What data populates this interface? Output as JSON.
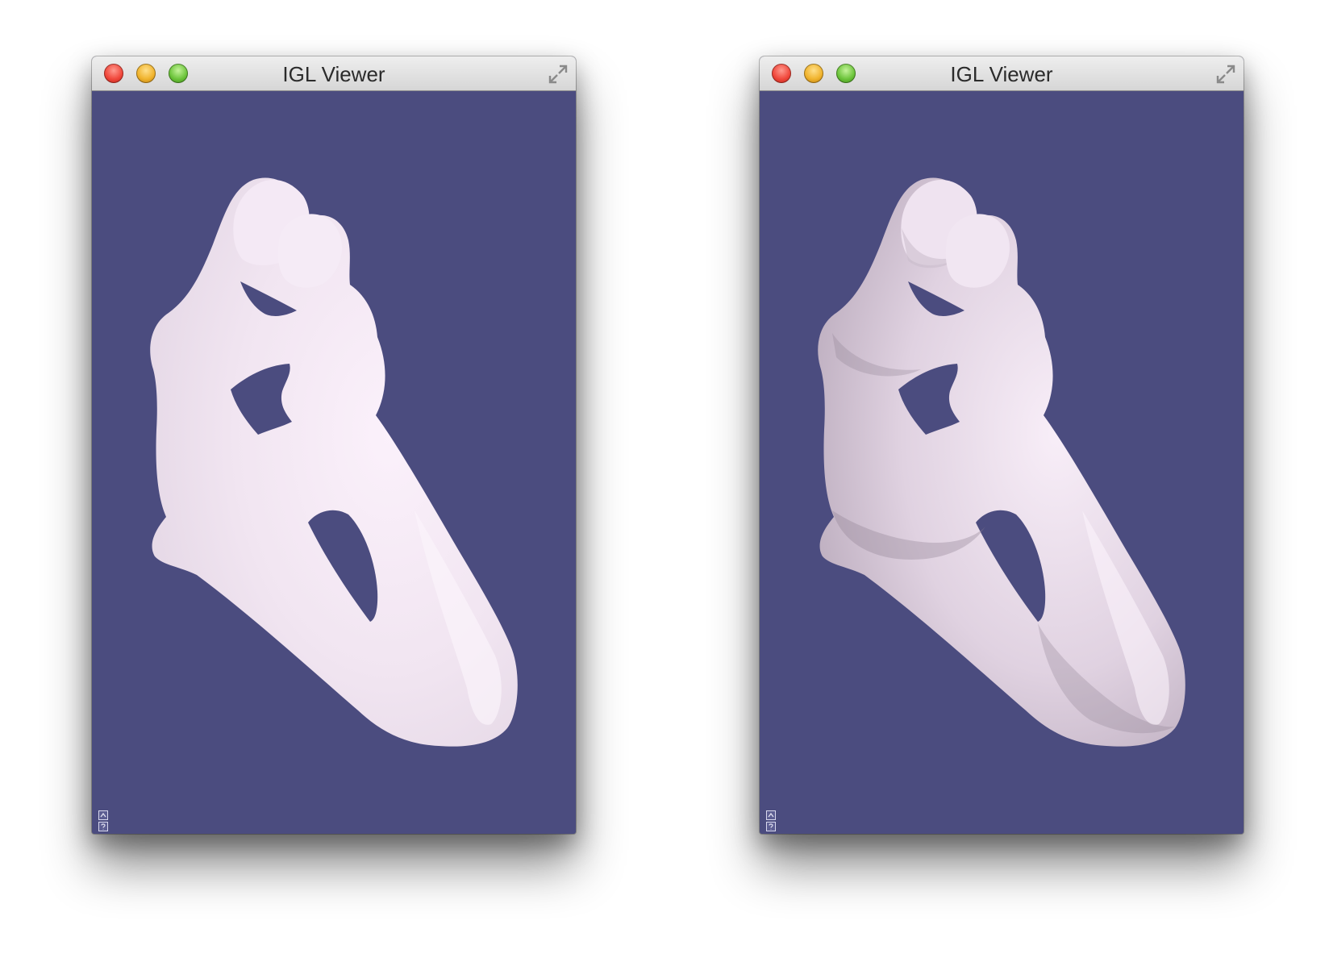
{
  "colors": {
    "viewport_background": "#4b4c7f",
    "model_base": "#f4e9f4",
    "titlebar": "#dcdcdc"
  },
  "windows": [
    {
      "title": "IGL Viewer",
      "shading": "flat-lighting",
      "icons": [
        "close-icon",
        "minimize-icon",
        "zoom-icon",
        "fullscreen-icon"
      ]
    },
    {
      "title": "IGL Viewer",
      "shading": "ambient-occlusion",
      "icons": [
        "close-icon",
        "minimize-icon",
        "zoom-icon",
        "fullscreen-icon"
      ]
    }
  ]
}
